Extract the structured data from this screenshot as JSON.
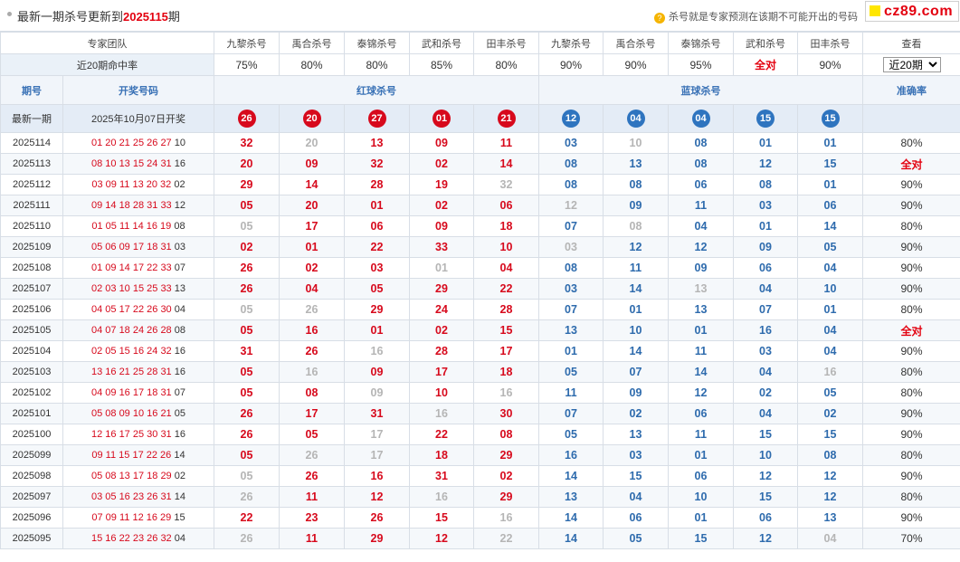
{
  "header": {
    "title_prefix": "最新一期杀号更新到",
    "title_issue": "2025115",
    "title_suffix": "期",
    "notice": "杀号就是专家预测在该期不可能开出的号码",
    "logo": "cz89.com"
  },
  "experts_label": "专家团队",
  "experts": [
    "九黎杀号",
    "禹合杀号",
    "泰锦杀号",
    "武和杀号",
    "田丰杀号",
    "九黎杀号",
    "禹合杀号",
    "泰锦杀号",
    "武和杀号",
    "田丰杀号"
  ],
  "view_label": "查看",
  "rate_label": "近20期命中率",
  "rates": [
    "75%",
    "80%",
    "80%",
    "85%",
    "80%",
    "90%",
    "90%",
    "95%",
    "全对",
    "90%"
  ],
  "period_select": {
    "value": "近20期",
    "options": [
      "近20期"
    ]
  },
  "columns": {
    "issue": "期号",
    "draw": "开奖号码",
    "red": "红球杀号",
    "blue": "蓝球杀号",
    "accuracy": "准确率"
  },
  "latest": {
    "label": "最新一期",
    "date": "2025年10月07日开奖",
    "red": [
      "26",
      "20",
      "27",
      "01",
      "21"
    ],
    "blue": [
      "12",
      "04",
      "04",
      "15",
      "15"
    ]
  },
  "rows": [
    {
      "issue": "2025114",
      "red_draw": "01 20 21 25 26 27",
      "blue_draw": "10",
      "kills": [
        "32",
        "20",
        "13",
        "09",
        "11",
        "03",
        "10",
        "08",
        "01",
        "01"
      ],
      "miss": [
        1,
        6
      ],
      "acc": "80%"
    },
    {
      "issue": "2025113",
      "red_draw": "08 10 13 15 24 31",
      "blue_draw": "16",
      "kills": [
        "20",
        "09",
        "32",
        "02",
        "14",
        "08",
        "13",
        "08",
        "12",
        "15"
      ],
      "miss": [],
      "acc": "全对"
    },
    {
      "issue": "2025112",
      "red_draw": "03 09 11 13 20 32",
      "blue_draw": "02",
      "kills": [
        "29",
        "14",
        "28",
        "19",
        "32",
        "08",
        "08",
        "06",
        "08",
        "01"
      ],
      "miss": [
        4
      ],
      "acc": "90%"
    },
    {
      "issue": "2025111",
      "red_draw": "09 14 18 28 31 33",
      "blue_draw": "12",
      "kills": [
        "05",
        "20",
        "01",
        "02",
        "06",
        "12",
        "09",
        "11",
        "03",
        "06"
      ],
      "miss": [
        5
      ],
      "acc": "90%"
    },
    {
      "issue": "2025110",
      "red_draw": "01 05 11 14 16 19",
      "blue_draw": "08",
      "kills": [
        "05",
        "17",
        "06",
        "09",
        "18",
        "07",
        "08",
        "04",
        "01",
        "14"
      ],
      "miss": [
        0,
        6
      ],
      "acc": "80%"
    },
    {
      "issue": "2025109",
      "red_draw": "05 06 09 17 18 31",
      "blue_draw": "03",
      "kills": [
        "02",
        "01",
        "22",
        "33",
        "10",
        "03",
        "12",
        "12",
        "09",
        "05"
      ],
      "miss": [
        5
      ],
      "acc": "90%"
    },
    {
      "issue": "2025108",
      "red_draw": "01 09 14 17 22 33",
      "blue_draw": "07",
      "kills": [
        "26",
        "02",
        "03",
        "01",
        "04",
        "08",
        "11",
        "09",
        "06",
        "04"
      ],
      "miss": [
        3
      ],
      "acc": "90%"
    },
    {
      "issue": "2025107",
      "red_draw": "02 03 10 15 25 33",
      "blue_draw": "13",
      "kills": [
        "26",
        "04",
        "05",
        "29",
        "22",
        "03",
        "14",
        "13",
        "04",
        "10"
      ],
      "miss": [
        7
      ],
      "acc": "90%"
    },
    {
      "issue": "2025106",
      "red_draw": "04 05 17 22 26 30",
      "blue_draw": "04",
      "kills": [
        "05",
        "26",
        "29",
        "24",
        "28",
        "07",
        "01",
        "13",
        "07",
        "01"
      ],
      "miss": [
        0,
        1
      ],
      "acc": "80%"
    },
    {
      "issue": "2025105",
      "red_draw": "04 07 18 24 26 28",
      "blue_draw": "08",
      "kills": [
        "05",
        "16",
        "01",
        "02",
        "15",
        "13",
        "10",
        "01",
        "16",
        "04"
      ],
      "miss": [],
      "acc": "全对"
    },
    {
      "issue": "2025104",
      "red_draw": "02 05 15 16 24 32",
      "blue_draw": "16",
      "kills": [
        "31",
        "26",
        "16",
        "28",
        "17",
        "01",
        "14",
        "11",
        "03",
        "04"
      ],
      "miss": [
        2
      ],
      "acc": "90%"
    },
    {
      "issue": "2025103",
      "red_draw": "13 16 21 25 28 31",
      "blue_draw": "16",
      "kills": [
        "05",
        "16",
        "09",
        "17",
        "18",
        "05",
        "07",
        "14",
        "04",
        "16"
      ],
      "miss": [
        1,
        9
      ],
      "acc": "80%"
    },
    {
      "issue": "2025102",
      "red_draw": "04 09 16 17 18 31",
      "blue_draw": "07",
      "kills": [
        "05",
        "08",
        "09",
        "10",
        "16",
        "11",
        "09",
        "12",
        "02",
        "05"
      ],
      "miss": [
        2,
        4
      ],
      "acc": "80%"
    },
    {
      "issue": "2025101",
      "red_draw": "05 08 09 10 16 21",
      "blue_draw": "05",
      "kills": [
        "26",
        "17",
        "31",
        "16",
        "30",
        "07",
        "02",
        "06",
        "04",
        "02"
      ],
      "miss": [
        3
      ],
      "acc": "90%"
    },
    {
      "issue": "2025100",
      "red_draw": "12 16 17 25 30 31",
      "blue_draw": "16",
      "kills": [
        "26",
        "05",
        "17",
        "22",
        "08",
        "05",
        "13",
        "11",
        "15",
        "15"
      ],
      "miss": [
        2
      ],
      "acc": "90%"
    },
    {
      "issue": "2025099",
      "red_draw": "09 11 15 17 22 26",
      "blue_draw": "14",
      "kills": [
        "05",
        "26",
        "17",
        "18",
        "29",
        "16",
        "03",
        "01",
        "10",
        "08"
      ],
      "miss": [
        1,
        2
      ],
      "acc": "80%"
    },
    {
      "issue": "2025098",
      "red_draw": "05 08 13 17 18 29",
      "blue_draw": "02",
      "kills": [
        "05",
        "26",
        "16",
        "31",
        "02",
        "14",
        "15",
        "06",
        "12",
        "12"
      ],
      "miss": [
        0
      ],
      "acc": "90%"
    },
    {
      "issue": "2025097",
      "red_draw": "03 05 16 23 26 31",
      "blue_draw": "14",
      "kills": [
        "26",
        "11",
        "12",
        "16",
        "29",
        "13",
        "04",
        "10",
        "15",
        "12"
      ],
      "miss": [
        0,
        3
      ],
      "acc": "80%"
    },
    {
      "issue": "2025096",
      "red_draw": "07 09 11 12 16 29",
      "blue_draw": "15",
      "kills": [
        "22",
        "23",
        "26",
        "15",
        "16",
        "14",
        "06",
        "01",
        "06",
        "13"
      ],
      "miss": [
        4
      ],
      "acc": "90%"
    },
    {
      "issue": "2025095",
      "red_draw": "15 16 22 23 26 32",
      "blue_draw": "04",
      "kills": [
        "26",
        "11",
        "29",
        "12",
        "22",
        "14",
        "05",
        "15",
        "12",
        "04"
      ],
      "miss": [
        0,
        4,
        9
      ],
      "acc": "70%"
    }
  ],
  "colors": {
    "red": "#d7091c",
    "blue": "#2e74bf",
    "miss": "#b5b5b5",
    "header_bg": "#f1f5fa"
  }
}
